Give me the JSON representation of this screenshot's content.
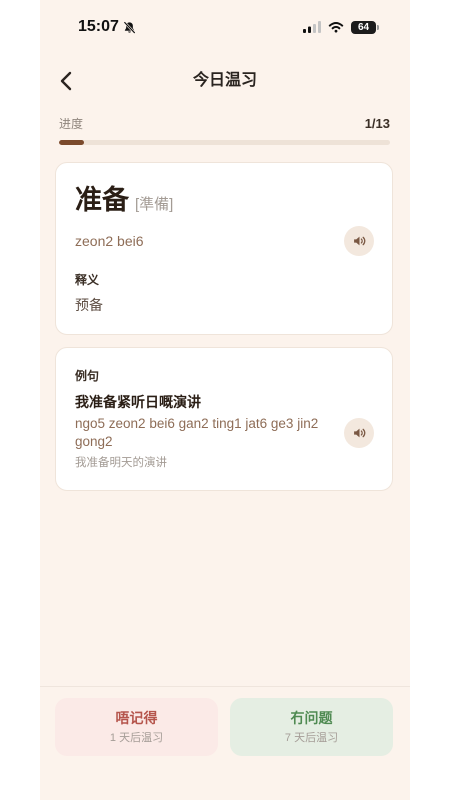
{
  "status_bar": {
    "time": "15:07",
    "battery": "64"
  },
  "header": {
    "title": "今日温习"
  },
  "progress": {
    "label": "进度",
    "text": "1/13",
    "current": 1,
    "total": 13
  },
  "word_card": {
    "word": "准备",
    "traditional": "[準備]",
    "jyutping": "zeon2 bei6",
    "meaning_label": "释义",
    "meaning": "预备"
  },
  "example_card": {
    "label": "例句",
    "sentence": "我准备紧听日嘅演讲",
    "jyutping": "ngo5 zeon2 bei6 gan2 ting1 jat6 ge3 jin2 gong2",
    "translation": "我准备明天的演讲"
  },
  "actions": {
    "forgot": {
      "label": "唔记得",
      "sub": "1 天后温习"
    },
    "ok": {
      "label": "冇问题",
      "sub": "7 天后温习"
    }
  },
  "icons": {
    "mute": "bell-slash-icon",
    "signal": "cellular-signal-icon",
    "wifi": "wifi-icon",
    "battery": "battery-icon",
    "back": "chevron-left-icon",
    "audio": "speaker-icon"
  },
  "colors": {
    "background": "#FCF3EC",
    "card": "#FFFFFF",
    "card_border": "#EFE4DA",
    "text_dark": "#2A1E15",
    "pronunciation": "#8E6D57",
    "muted": "#A39B94",
    "progress_fill": "#7B4A2C",
    "progress_track": "#EEE2D7",
    "speaker_bg": "#F3E8DE",
    "speaker_icon": "#7A5843",
    "forgot_bg": "#FBEAE7",
    "forgot_text": "#B5554C",
    "ok_bg": "#E5EEE3",
    "ok_text": "#4F8A52"
  }
}
